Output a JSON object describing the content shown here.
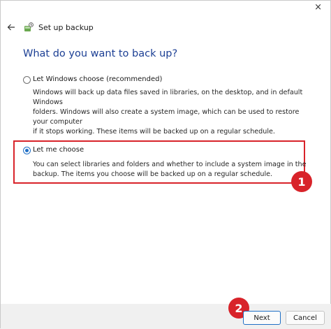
{
  "window": {
    "title": "Set up backup",
    "close_glyph": "×",
    "icons": {
      "back": "back-arrow-icon",
      "app": "backup-app-icon"
    }
  },
  "heading": "What do you want to back up?",
  "options": [
    {
      "label": "Let Windows choose (recommended)",
      "selected": false,
      "description": "Windows will back up data files saved in libraries, on the desktop, and in default Windows\nfolders. Windows will also create a system image, which can be used to restore your computer\nif it stops working. These items will be backed up on a regular schedule."
    },
    {
      "label": "Let me choose",
      "selected": true,
      "description": "You can select libraries and folders and whether to include a system image in the\nbackup. The items you choose will be backed up on a regular schedule."
    }
  ],
  "annotations": {
    "badge1": "1",
    "badge2": "2",
    "color": "#d8232a"
  },
  "buttons": {
    "next": "Next",
    "cancel": "Cancel"
  },
  "colors": {
    "heading": "#1c3f94",
    "accent": "#1f6fc6"
  }
}
